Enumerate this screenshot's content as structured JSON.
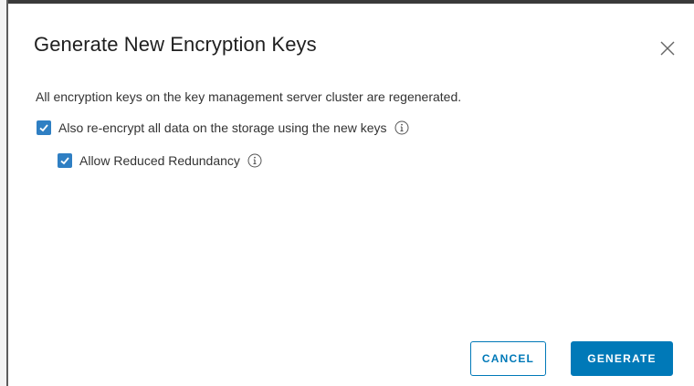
{
  "dialog": {
    "title": "Generate New Encryption Keys",
    "close_icon": "close-icon",
    "description": "All encryption keys on the key management server cluster are regenerated.",
    "options": [
      {
        "label": "Also re-encrypt all data on the storage using the new keys",
        "checked": true,
        "icon": "info-icon"
      },
      {
        "label": "Allow Reduced Redundancy",
        "checked": true,
        "icon": "info-icon"
      }
    ],
    "buttons": {
      "cancel": "CANCEL",
      "generate": "GENERATE"
    }
  },
  "colors": {
    "accent": "#0079b8",
    "checkbox": "#2f7fc3"
  }
}
